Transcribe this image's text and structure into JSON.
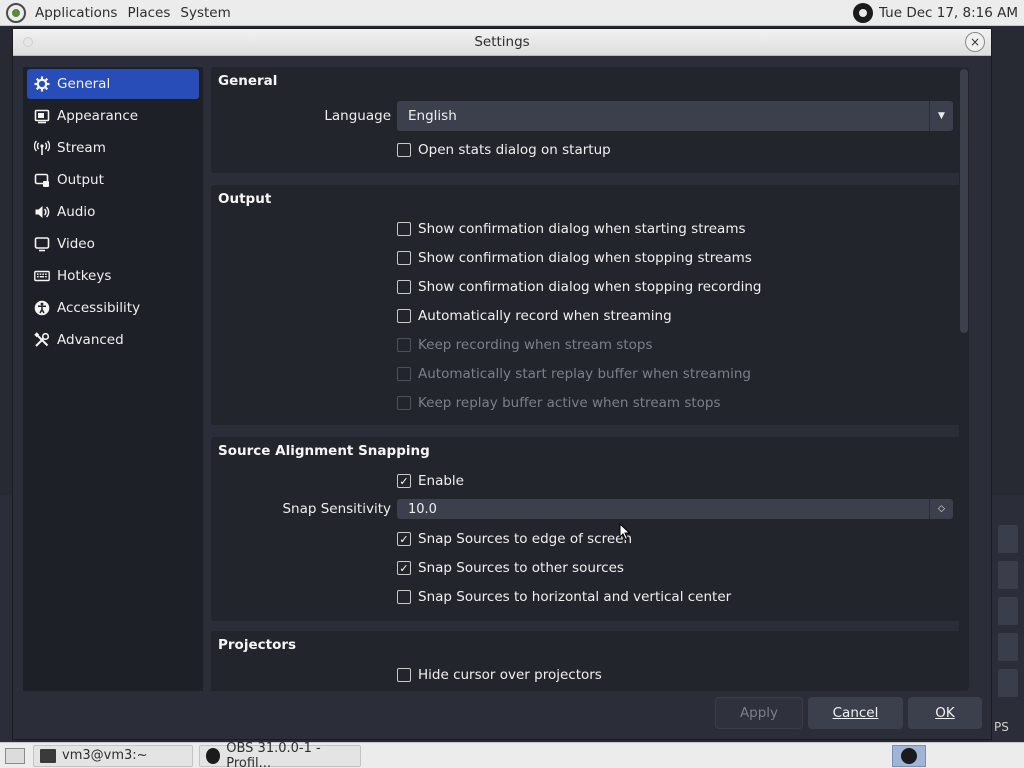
{
  "top_panel": {
    "menus": [
      "Applications",
      "Places",
      "System"
    ],
    "clock": "Tue Dec 17,  8:16 AM"
  },
  "dialog": {
    "title": "Settings",
    "close_glyph": "×"
  },
  "sidebar": {
    "items": [
      {
        "label": "General",
        "icon": "gear-icon",
        "active": true
      },
      {
        "label": "Appearance",
        "icon": "appearance-icon",
        "active": false
      },
      {
        "label": "Stream",
        "icon": "antenna-icon",
        "active": false
      },
      {
        "label": "Output",
        "icon": "output-icon",
        "active": false
      },
      {
        "label": "Audio",
        "icon": "speaker-icon",
        "active": false
      },
      {
        "label": "Video",
        "icon": "monitor-icon",
        "active": false
      },
      {
        "label": "Hotkeys",
        "icon": "keyboard-icon",
        "active": false
      },
      {
        "label": "Accessibility",
        "icon": "accessibility-icon",
        "active": false
      },
      {
        "label": "Advanced",
        "icon": "tools-icon",
        "active": false
      }
    ]
  },
  "general": {
    "title": "General",
    "language_label": "Language",
    "language_value": "English",
    "stats_label": "Open stats dialog on startup",
    "stats_checked": false
  },
  "output": {
    "title": "Output",
    "options": [
      {
        "label": "Show confirmation dialog when starting streams",
        "checked": false,
        "enabled": true
      },
      {
        "label": "Show confirmation dialog when stopping streams",
        "checked": false,
        "enabled": true
      },
      {
        "label": "Show confirmation dialog when stopping recording",
        "checked": false,
        "enabled": true
      },
      {
        "label": "Automatically record when streaming",
        "checked": false,
        "enabled": true
      },
      {
        "label": "Keep recording when stream stops",
        "checked": false,
        "enabled": false
      },
      {
        "label": "Automatically start replay buffer when streaming",
        "checked": false,
        "enabled": false
      },
      {
        "label": "Keep replay buffer active when stream stops",
        "checked": false,
        "enabled": false
      }
    ]
  },
  "snapping": {
    "title": "Source Alignment Snapping",
    "enable_label": "Enable",
    "enable_checked": true,
    "sensitivity_label": "Snap Sensitivity",
    "sensitivity_value": "10.0",
    "options": [
      {
        "label": "Snap Sources to edge of screen",
        "checked": true
      },
      {
        "label": "Snap Sources to other sources",
        "checked": true
      },
      {
        "label": "Snap Sources to horizontal and vertical center",
        "checked": false
      }
    ]
  },
  "projectors": {
    "title": "Projectors",
    "hide_cursor_label": "Hide cursor over projectors",
    "hide_cursor_checked": false
  },
  "buttons": {
    "apply": "Apply",
    "cancel": "Cancel",
    "ok": "OK"
  },
  "taskbar": {
    "terminal_label": "vm3@vm3:~",
    "obs_label": "OBS 31.0.0-1 - Profil..."
  },
  "background": {
    "fps_fragment": "PS"
  }
}
